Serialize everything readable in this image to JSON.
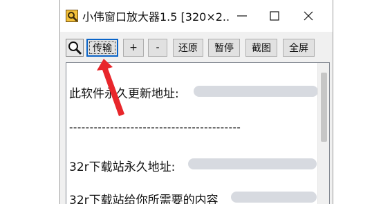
{
  "window": {
    "title": "小伟窗口放大器1.5 [320×2..."
  },
  "toolbar": {
    "magnifier_icon": "magnifier-icon",
    "buttons": [
      {
        "label": "传输"
      },
      {
        "label": "+"
      },
      {
        "label": "-"
      },
      {
        "label": "还原"
      },
      {
        "label": "暂停"
      },
      {
        "label": "截图"
      },
      {
        "label": "全屏"
      }
    ]
  },
  "content": {
    "lines": [
      "此软件永久更新地址:",
      "------------------------------------------",
      "32r下载站永久地址:",
      "32r下载站给你所需要的内容"
    ]
  },
  "colors": {
    "annotation_arrow": "#e8262b",
    "default_button_border": "#0a64c8"
  }
}
